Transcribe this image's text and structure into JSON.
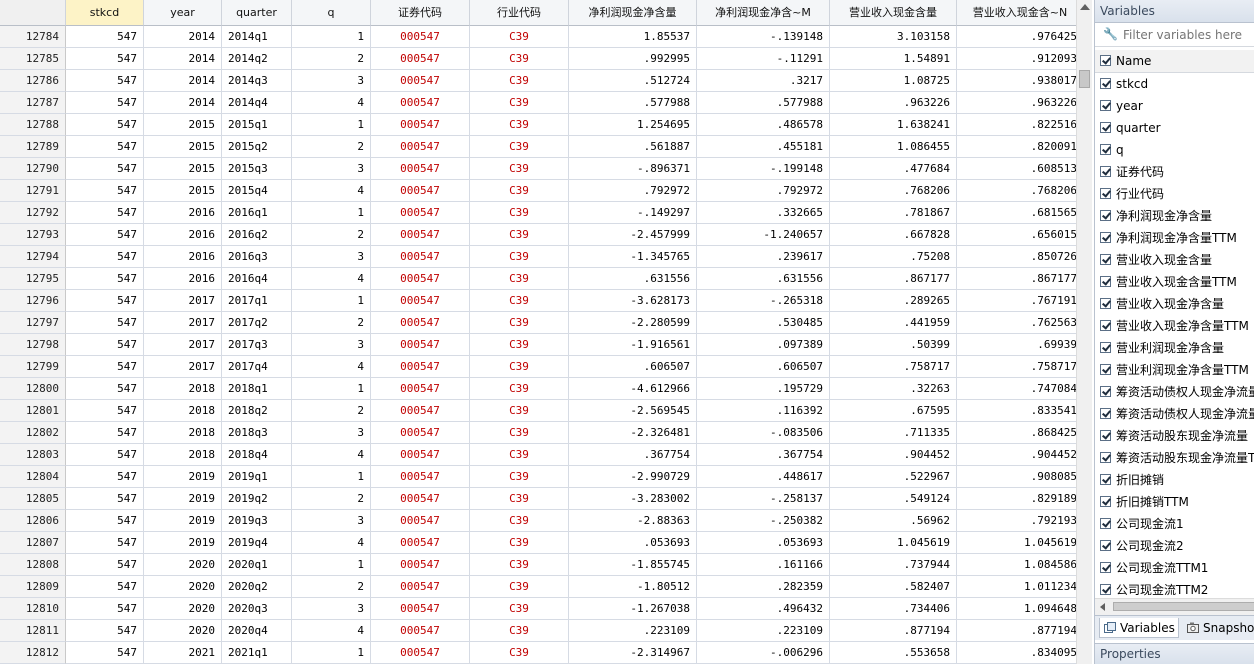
{
  "columns": [
    {
      "key": "stkcd",
      "label": "stkcd"
    },
    {
      "key": "year",
      "label": "year"
    },
    {
      "key": "quarter",
      "label": "quarter"
    },
    {
      "key": "q",
      "label": "q"
    },
    {
      "key": "seccode",
      "label": "证券代码"
    },
    {
      "key": "indcode",
      "label": "行业代码"
    },
    {
      "key": "np_cash",
      "label": "净利润现金净含量"
    },
    {
      "key": "np_cash_m",
      "label": "净利润现金净含~M"
    },
    {
      "key": "rev_cash",
      "label": "营业收入现金含量"
    },
    {
      "key": "rev_cash_n",
      "label": "营业收入现金含~N"
    }
  ],
  "rows": [
    [
      "12784",
      "547",
      "2014",
      "2014q1",
      "1",
      "000547",
      "C39",
      "1.85537",
      "-.139148",
      "3.103158",
      ".976425"
    ],
    [
      "12785",
      "547",
      "2014",
      "2014q2",
      "2",
      "000547",
      "C39",
      ".992995",
      "-.11291",
      "1.54891",
      ".912093"
    ],
    [
      "12786",
      "547",
      "2014",
      "2014q3",
      "3",
      "000547",
      "C39",
      ".512724",
      ".3217",
      "1.08725",
      ".938017"
    ],
    [
      "12787",
      "547",
      "2014",
      "2014q4",
      "4",
      "000547",
      "C39",
      ".577988",
      ".577988",
      ".963226",
      ".963226"
    ],
    [
      "12788",
      "547",
      "2015",
      "2015q1",
      "1",
      "000547",
      "C39",
      "1.254695",
      ".486578",
      "1.638241",
      ".822516"
    ],
    [
      "12789",
      "547",
      "2015",
      "2015q2",
      "2",
      "000547",
      "C39",
      ".561887",
      ".455181",
      "1.086455",
      ".820091"
    ],
    [
      "12790",
      "547",
      "2015",
      "2015q3",
      "3",
      "000547",
      "C39",
      "-.896371",
      "-.199148",
      ".477684",
      ".608513"
    ],
    [
      "12791",
      "547",
      "2015",
      "2015q4",
      "4",
      "000547",
      "C39",
      ".792972",
      ".792972",
      ".768206",
      ".768206"
    ],
    [
      "12792",
      "547",
      "2016",
      "2016q1",
      "1",
      "000547",
      "C39",
      "-.149297",
      ".332665",
      ".781867",
      ".681565"
    ],
    [
      "12793",
      "547",
      "2016",
      "2016q2",
      "2",
      "000547",
      "C39",
      "-2.457999",
      "-1.240657",
      ".667828",
      ".656015"
    ],
    [
      "12794",
      "547",
      "2016",
      "2016q3",
      "3",
      "000547",
      "C39",
      "-1.345765",
      ".239617",
      ".75208",
      ".850726"
    ],
    [
      "12795",
      "547",
      "2016",
      "2016q4",
      "4",
      "000547",
      "C39",
      ".631556",
      ".631556",
      ".867177",
      ".867177"
    ],
    [
      "12796",
      "547",
      "2017",
      "2017q1",
      "1",
      "000547",
      "C39",
      "-3.628173",
      "-.265318",
      ".289265",
      ".767191"
    ],
    [
      "12797",
      "547",
      "2017",
      "2017q2",
      "2",
      "000547",
      "C39",
      "-2.280599",
      ".530485",
      ".441959",
      ".762563"
    ],
    [
      "12798",
      "547",
      "2017",
      "2017q3",
      "3",
      "000547",
      "C39",
      "-1.916561",
      ".097389",
      ".50399",
      ".69939"
    ],
    [
      "12799",
      "547",
      "2017",
      "2017q4",
      "4",
      "000547",
      "C39",
      ".606507",
      ".606507",
      ".758717",
      ".758717"
    ],
    [
      "12800",
      "547",
      "2018",
      "2018q1",
      "1",
      "000547",
      "C39",
      "-4.612966",
      ".195729",
      ".32263",
      ".747084"
    ],
    [
      "12801",
      "547",
      "2018",
      "2018q2",
      "2",
      "000547",
      "C39",
      "-2.569545",
      ".116392",
      ".67595",
      ".833541"
    ],
    [
      "12802",
      "547",
      "2018",
      "2018q3",
      "3",
      "000547",
      "C39",
      "-2.326481",
      "-.083506",
      ".711335",
      ".868425"
    ],
    [
      "12803",
      "547",
      "2018",
      "2018q4",
      "4",
      "000547",
      "C39",
      ".367754",
      ".367754",
      ".904452",
      ".904452"
    ],
    [
      "12804",
      "547",
      "2019",
      "2019q1",
      "1",
      "000547",
      "C39",
      "-2.990729",
      ".448617",
      ".522967",
      ".908085"
    ],
    [
      "12805",
      "547",
      "2019",
      "2019q2",
      "2",
      "000547",
      "C39",
      "-3.283002",
      "-.258137",
      ".549124",
      ".829189"
    ],
    [
      "12806",
      "547",
      "2019",
      "2019q3",
      "3",
      "000547",
      "C39",
      "-2.88363",
      "-.250382",
      ".56962",
      ".792193"
    ],
    [
      "12807",
      "547",
      "2019",
      "2019q4",
      "4",
      "000547",
      "C39",
      ".053693",
      ".053693",
      "1.045619",
      "1.045619"
    ],
    [
      "12808",
      "547",
      "2020",
      "2020q1",
      "1",
      "000547",
      "C39",
      "-1.855745",
      ".161166",
      ".737944",
      "1.084586"
    ],
    [
      "12809",
      "547",
      "2020",
      "2020q2",
      "2",
      "000547",
      "C39",
      "-1.80512",
      ".282359",
      ".582407",
      "1.011234"
    ],
    [
      "12810",
      "547",
      "2020",
      "2020q3",
      "3",
      "000547",
      "C39",
      "-1.267038",
      ".496432",
      ".734406",
      "1.094648"
    ],
    [
      "12811",
      "547",
      "2020",
      "2020q4",
      "4",
      "000547",
      "C39",
      ".223109",
      ".223109",
      ".877194",
      ".877194"
    ],
    [
      "12812",
      "547",
      "2021",
      "2021q1",
      "1",
      "000547",
      "C39",
      "-2.314967",
      "-.006296",
      ".553658",
      ".834095"
    ]
  ],
  "panel": {
    "title": "Variables",
    "filter_placeholder": "Filter variables here",
    "name_header": "Name",
    "variables": [
      "stkcd",
      "year",
      "quarter",
      "q",
      "证券代码",
      "行业代码",
      "净利润现金净含量",
      "净利润现金净含量TTM",
      "营业收入现金含量",
      "营业收入现金含量TTM",
      "营业收入现金净含量",
      "营业收入现金净含量TTM",
      "营业利润现金净含量",
      "营业利润现金净含量TTM",
      "筹资活动债权人现金净流量",
      "筹资活动债权人现金净流量",
      "筹资活动股东现金净流量",
      "筹资活动股东现金净流量TTM",
      "折旧摊销",
      "折旧摊销TTM",
      "公司现金流1",
      "公司现金流2",
      "公司现金流TTM1",
      "公司现金流TTM2"
    ],
    "tabs": {
      "variables": "Variables",
      "snapshots": "Snapshots"
    },
    "properties_title": "Properties"
  },
  "colors": {
    "code_red": "#c00000",
    "header_selected": "#fdf3c7"
  }
}
